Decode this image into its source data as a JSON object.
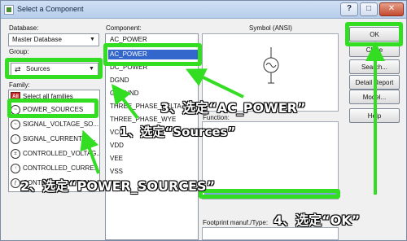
{
  "window": {
    "title": "Select a Component"
  },
  "left": {
    "database_label": "Database:",
    "database_value": "Master Database",
    "group_label": "Group:",
    "group_value": "Sources",
    "family_label": "Family:",
    "families": [
      {
        "icon": "all-families-icon",
        "label": "Select all families"
      },
      {
        "icon": "power-source-icon",
        "label": "POWER_SOURCES"
      },
      {
        "icon": "signal-voltage-icon",
        "label": "SIGNAL_VOLTAGE_SO..."
      },
      {
        "icon": "signal-current-icon",
        "label": "SIGNAL_CURRENT_S..."
      },
      {
        "icon": "controlled-voltage-icon",
        "label": "CONTROLLED_VOLTAG..."
      },
      {
        "icon": "controlled-current-icon",
        "label": "CONTROLLED_CURRE..."
      },
      {
        "icon": "control-function-icon",
        "label": "CONTROL_FUNCTION..."
      }
    ]
  },
  "components": {
    "label": "Component:",
    "value": "AC_POWER",
    "items": [
      "AC_POWER",
      "AC_POWER",
      "DC_POWER",
      "DGND",
      "GROUND",
      "THREE_PHASE_DELTA",
      "THREE_PHASE_WYE",
      "VCC",
      "VDD",
      "VEE",
      "VSS"
    ],
    "selected_index": 1
  },
  "symbol": {
    "label": "Symbol (ANSI)"
  },
  "function": {
    "label": "Function:"
  },
  "footprint": {
    "label": "Footprint manuf./Type:"
  },
  "buttons": [
    "OK",
    "Close",
    "Search...",
    "Detail Report",
    "Model...",
    "Help"
  ],
  "annotations": {
    "step1": "1、选定“Sources”",
    "step2": "2、选定“POWER_SOURCES”",
    "step3": "3、选定“AC_POWER”",
    "step4": "4、选定“OK”",
    "color": "#33dd22"
  }
}
